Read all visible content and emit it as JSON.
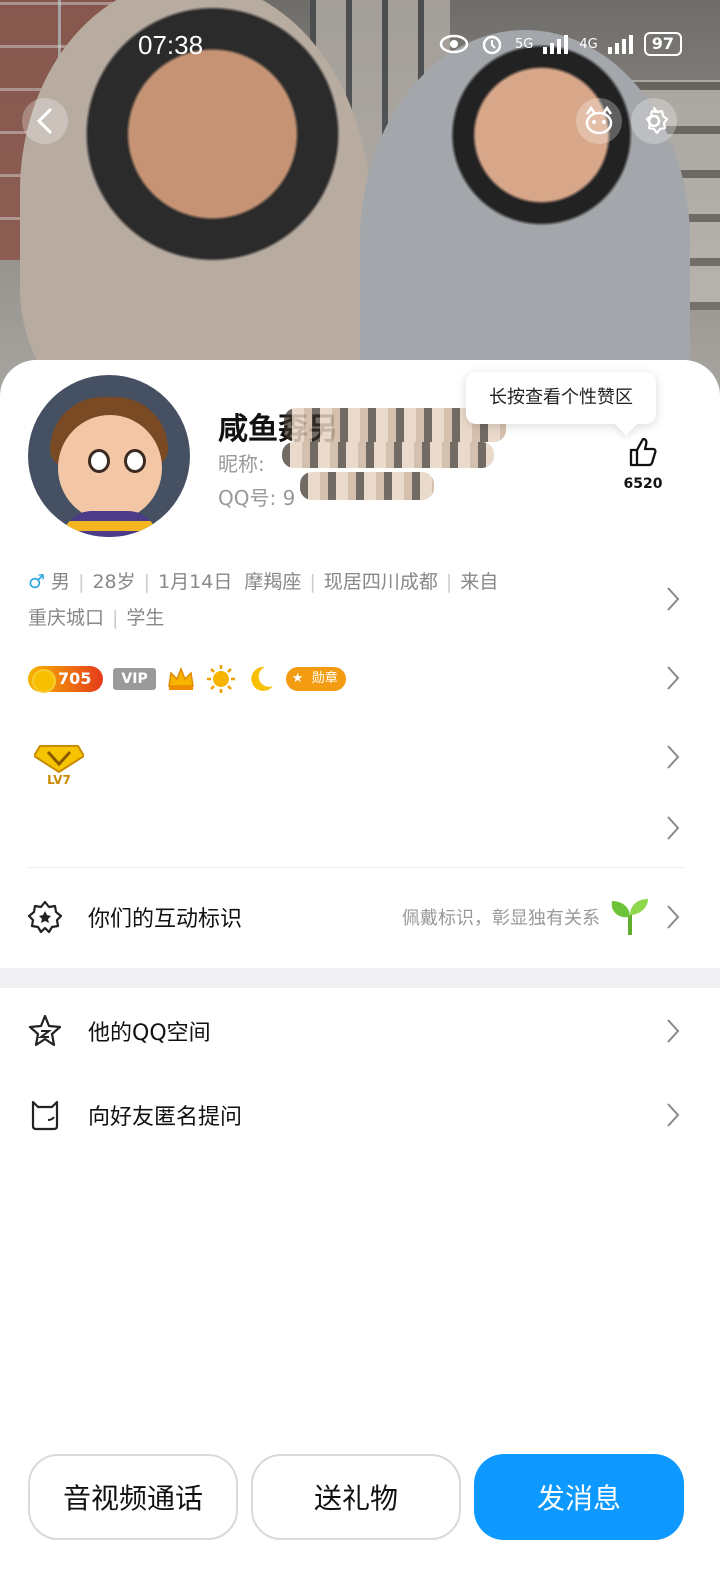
{
  "status_bar": {
    "time": "07:38",
    "net1": "5G",
    "net2": "4G",
    "battery": "97"
  },
  "profile": {
    "name": "咸鱼孬另",
    "nickname_label": "昵称:",
    "qq_label": "QQ号:",
    "qq_partial": "9"
  },
  "like": {
    "tooltip": "长按查看个性赞区",
    "count": "6520"
  },
  "info": {
    "gender": "男",
    "age": "28岁",
    "birthday": "1月14日",
    "zodiac": "摩羯座",
    "location": "现居四川成都",
    "origin": "来自重庆城口",
    "origin_line1": "来自",
    "origin_line2": "重庆城口",
    "job": "学生"
  },
  "badges": {
    "level": "705",
    "vip": "VIP",
    "medal": "勋章",
    "lv": "LV7"
  },
  "rows": {
    "interaction_label": "你们的互动标识",
    "interaction_hint": "佩戴标识，彰显独有关系",
    "qzone_label": "他的QQ空间",
    "anon_label": "向好友匿名提问"
  },
  "actions": {
    "call": "音视频通话",
    "gift": "送礼物",
    "message": "发消息"
  },
  "colors": {
    "primary": "#0d99ff",
    "male": "#2aa4e0"
  },
  "icons": [
    "back-icon",
    "pet-icon",
    "gear-icon",
    "thumbs-up-icon",
    "chevron-right-icon",
    "badge-icon",
    "star-icon",
    "cat-icon",
    "sprout-icon"
  ]
}
